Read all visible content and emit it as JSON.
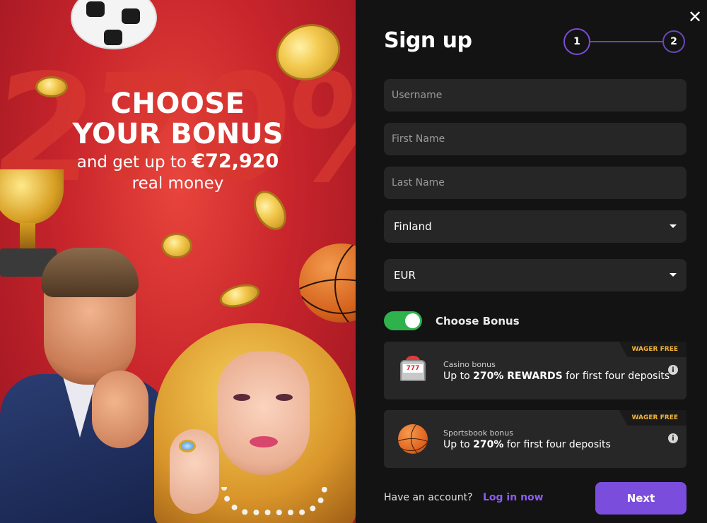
{
  "promo": {
    "bg_text": "270%",
    "line1": "CHOOSE",
    "line2": "YOUR BONUS",
    "line3_prefix": "and get up to ",
    "line3_amount": "€72,920",
    "line4": "real money"
  },
  "form": {
    "title": "Sign up",
    "close_icon": "✕",
    "steps": [
      "1",
      "2"
    ],
    "fields": {
      "username_placeholder": "Username",
      "first_name_placeholder": "First Name",
      "last_name_placeholder": "Last Name",
      "country_value": "Finland",
      "currency_value": "EUR"
    },
    "bonus_toggle_label": "Choose Bonus",
    "bonus_toggle_on": true,
    "bonuses": [
      {
        "badge": "WAGER FREE",
        "title": "Casino bonus",
        "desc_prefix": "Up to ",
        "desc_bold": "270% REWARDS",
        "desc_suffix": " for first four deposits",
        "icon": "slot-machine-icon",
        "slot_text": "777"
      },
      {
        "badge": "WAGER FREE",
        "title": "Sportsbook bonus",
        "desc_prefix": "Up to ",
        "desc_bold": "270%",
        "desc_suffix": " for first four deposits",
        "icon": "basketball-icon"
      }
    ],
    "footer": {
      "account_text": "Have an account?",
      "login_link": "Log in now",
      "next_button": "Next"
    }
  },
  "colors": {
    "accent": "#7a4ddd",
    "toggle_on": "#2fb24c",
    "badge_text": "#f2b33a",
    "promo_red": "#c8252c"
  }
}
